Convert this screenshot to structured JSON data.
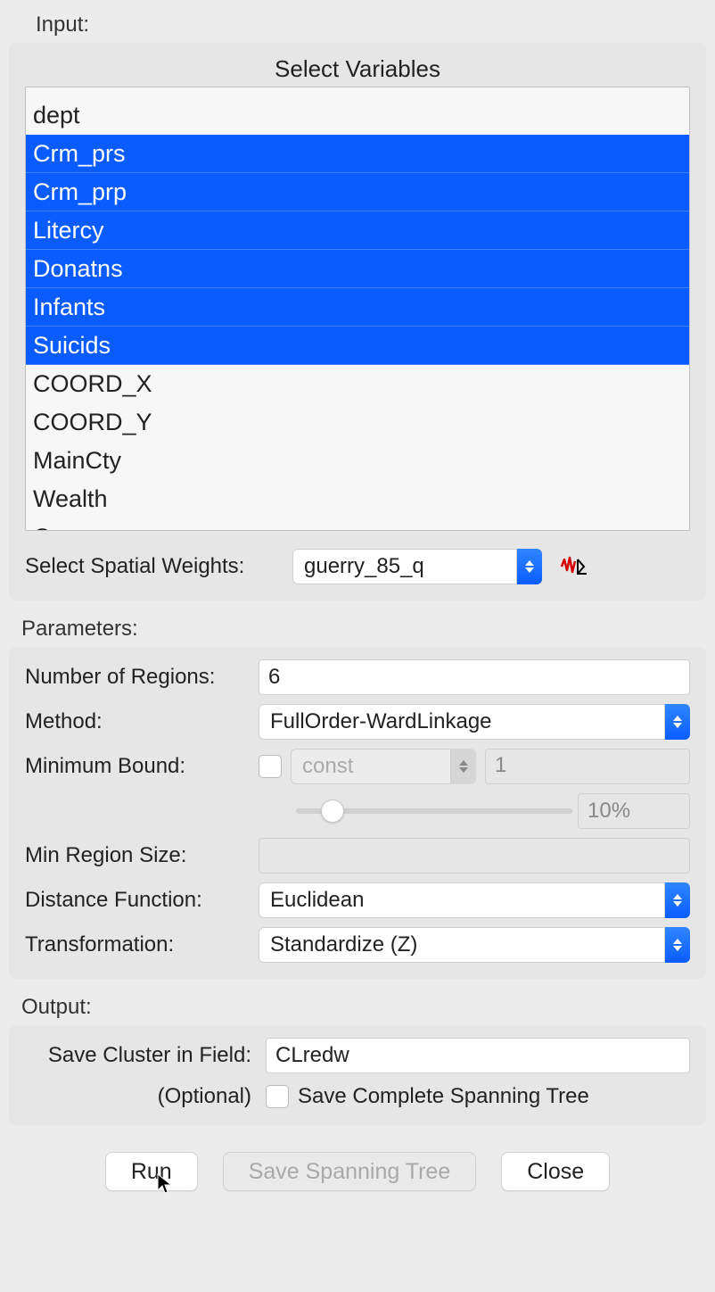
{
  "input": {
    "section_label": "Input:",
    "title": "Select Variables",
    "variables": [
      {
        "label": "",
        "selected": false,
        "fragment": true
      },
      {
        "label": "dept",
        "selected": false
      },
      {
        "label": "Crm_prs",
        "selected": true
      },
      {
        "label": "Crm_prp",
        "selected": true
      },
      {
        "label": "Litercy",
        "selected": true
      },
      {
        "label": "Donatns",
        "selected": true
      },
      {
        "label": "Infants",
        "selected": true
      },
      {
        "label": "Suicids",
        "selected": true
      },
      {
        "label": "COORD_X",
        "selected": false
      },
      {
        "label": "COORD_Y",
        "selected": false
      },
      {
        "label": "MainCty",
        "selected": false
      },
      {
        "label": "Wealth",
        "selected": false
      },
      {
        "label": "Commerc",
        "selected": false
      }
    ],
    "weights_label": "Select Spatial Weights:",
    "weights_value": "guerry_85_q"
  },
  "parameters": {
    "section_label": "Parameters:",
    "num_regions_label": "Number of Regions:",
    "num_regions_value": "6",
    "method_label": "Method:",
    "method_value": "FullOrder-WardLinkage",
    "min_bound_label": "Minimum Bound:",
    "min_bound_select": "const",
    "min_bound_value": "1",
    "slider_pct": "10%",
    "min_region_label": "Min Region Size:",
    "min_region_value": "",
    "distance_label": "Distance Function:",
    "distance_value": "Euclidean",
    "transform_label": "Transformation:",
    "transform_value": "Standardize (Z)"
  },
  "output": {
    "section_label": "Output:",
    "save_field_label": "Save Cluster in Field:",
    "save_field_value": "CLredw",
    "optional_label": "(Optional)",
    "spanning_checkbox_label": "Save Complete Spanning Tree"
  },
  "buttons": {
    "run": "Run",
    "save_spanning": "Save Spanning Tree",
    "close": "Close"
  }
}
